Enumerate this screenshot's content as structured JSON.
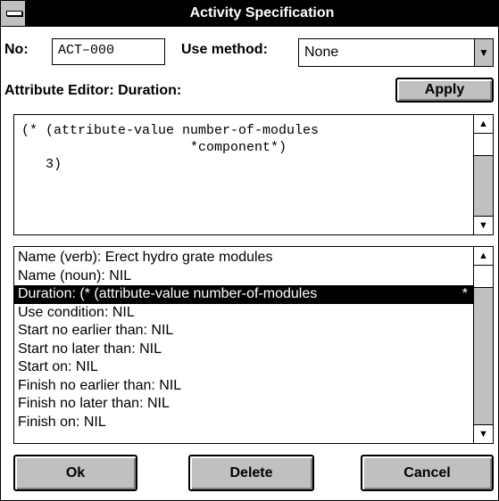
{
  "window": {
    "title": "Activity Specification"
  },
  "no_field": {
    "label": "No:",
    "value": "ACT–000"
  },
  "use_method": {
    "label": "Use method:",
    "value": "None"
  },
  "editor": {
    "label": "Attribute Editor: Duration:",
    "apply_label": "Apply",
    "text": "(* (attribute-value number-of-modules\n                     *component*)\n   3)"
  },
  "attributes": [
    {
      "text": "Name (verb): Erect hydro grate modules"
    },
    {
      "text": "Name (noun): NIL"
    },
    {
      "text": "Duration: (* (attribute-value number-of-modules",
      "selected": true,
      "mark": "*"
    },
    {
      "text": "Use condition: NIL"
    },
    {
      "text": "Start no earlier than: NIL"
    },
    {
      "text": "Start no later than: NIL"
    },
    {
      "text": "Start on: NIL"
    },
    {
      "text": "Finish no earlier than: NIL"
    },
    {
      "text": "Finish no later than: NIL"
    },
    {
      "text": "Finish on: NIL"
    }
  ],
  "buttons": {
    "ok": "Ok",
    "delete": "Delete",
    "cancel": "Cancel"
  },
  "icons": {
    "system_menu": "system-menu-icon",
    "dropdown": "dropdown-arrow-icon",
    "scroll_up": "scroll-up-arrow-icon",
    "scroll_down": "scroll-down-arrow-icon"
  }
}
